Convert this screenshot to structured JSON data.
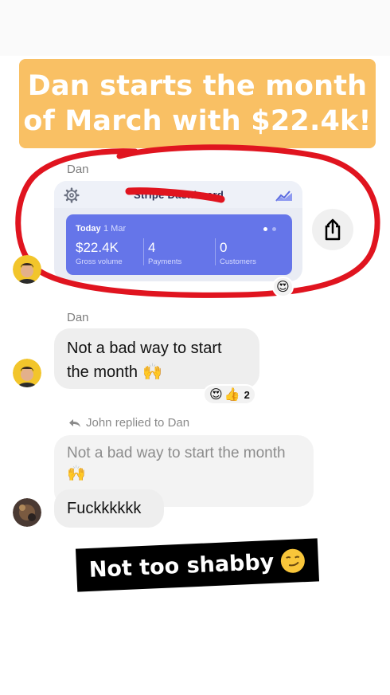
{
  "banner": {
    "line1": "Dan starts the month",
    "line2": "of March with $22.4k!"
  },
  "messages": {
    "first_sender": "Dan",
    "second_sender": "Dan",
    "second_text_line1": "Not a bad way to start",
    "second_text_line2": "the month",
    "second_reaction_count": "2",
    "reply_note": "John replied to Dan",
    "quoted_line1": "Not a bad way to start the month",
    "reply_text": "Fuckkkkkk"
  },
  "card": {
    "title": "Stripe Dashboard",
    "today_label": "Today",
    "today_date": "1 Mar",
    "stats": [
      {
        "value": "$22.4K",
        "label": "Gross volume"
      },
      {
        "value": "4",
        "label": "Payments"
      },
      {
        "value": "0",
        "label": "Customers"
      }
    ]
  },
  "caption": {
    "text": "Not too shabby"
  },
  "colors": {
    "banner": "#f9c064",
    "stats_panel": "#6575e9",
    "annotation_red": "#e0141f",
    "bubble": "#eeeeee"
  },
  "icons": [
    "gear-icon",
    "chart-icon",
    "share-icon",
    "reply-arrow-icon",
    "heart-eyes-icon",
    "thumbs-up-icon",
    "raised-hands-icon",
    "smirk-icon"
  ]
}
